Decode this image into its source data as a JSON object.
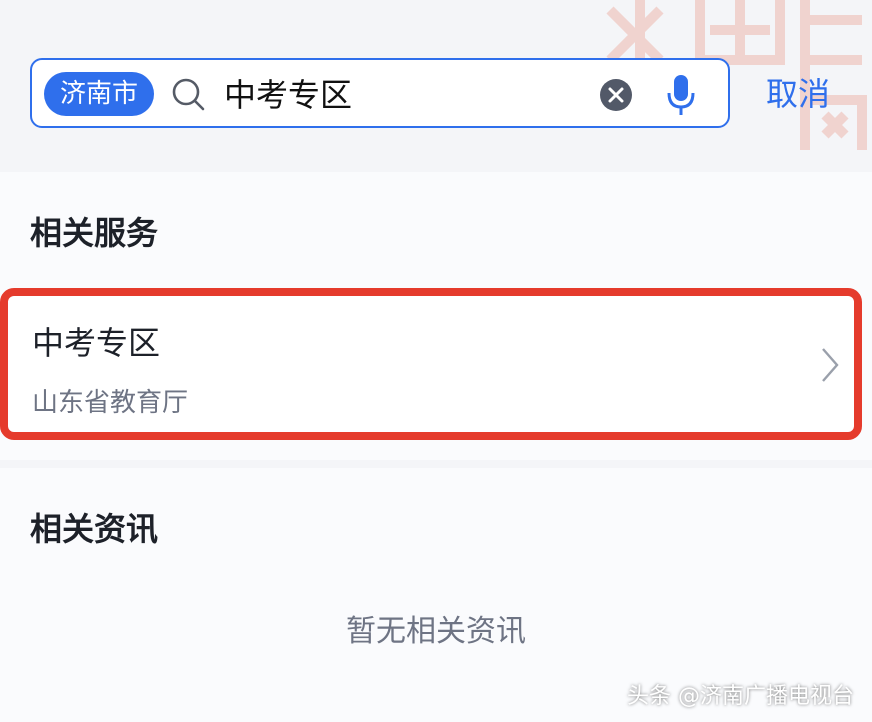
{
  "search": {
    "city": "济南市",
    "query": "中考专区",
    "cancel_label": "取消"
  },
  "services": {
    "title": "相关服务",
    "items": [
      {
        "title": "中考专区",
        "subtitle": "山东省教育厅"
      }
    ]
  },
  "news": {
    "title": "相关资讯",
    "empty_text": "暂无相关资讯"
  },
  "watermark": "头条 @济南广播电视台",
  "colors": {
    "accent": "#2f6fec",
    "highlight": "#e53b2c"
  },
  "icons": [
    "search-icon",
    "clear-icon",
    "microphone-icon",
    "chevron-right-icon"
  ]
}
